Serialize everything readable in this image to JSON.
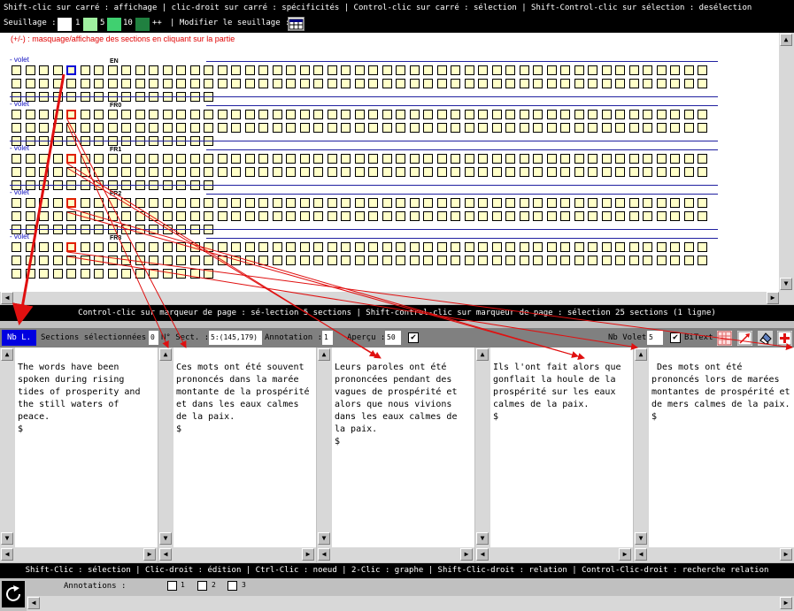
{
  "top_hint": "Shift-clic sur carré : affichage | clic-droit sur carré : spécificités | Control-clic sur carré : sélection | Shift-Control-clic sur sélection : desélection",
  "seuil": {
    "label": "Seuillage :",
    "levels": [
      {
        "value": "1",
        "color": "#ffffff"
      },
      {
        "value": "5",
        "color": "#a0f0a0"
      },
      {
        "value": "10",
        "color": "#40d070"
      },
      {
        "value": "++",
        "color": "#208040"
      }
    ],
    "modify_label": "| Modifier le seuillage :"
  },
  "mask_hint": "(+/-) : masquage/affichage des sections en cliquant sur la partie",
  "volets": [
    {
      "label": "- volet",
      "lang": "EN"
    },
    {
      "label": "- volet",
      "lang": "FR0"
    },
    {
      "label": "- volet",
      "lang": "FR1"
    },
    {
      "label": "- volet",
      "lang": "FR2"
    },
    {
      "label": "- volet",
      "lang": "FR3"
    }
  ],
  "mid_hint": "Control-clic sur marqueur de page : sé-lection 5 sections | Shift-control-clic sur marqueur de page : sélection 25 sections (1 ligne)",
  "toolbar": {
    "nb_l": "Nb L.",
    "sections_label": "Sections sélectionnées :",
    "sections_value": "0",
    "nsect_label": "N° Sect. :",
    "nsect_value": "5:(145,179)",
    "annotation_label": "Annotation :",
    "annotation_value": "1",
    "apercu_label": "Aperçu :",
    "apercu_value": "50",
    "nb_volet_label": "Nb Volet",
    "nb_volet_value": "5",
    "bitext_label": "BiText"
  },
  "columns": [
    {
      "text": "The words have been spoken during rising tides of prosperity and the still waters of peace.\n$"
    },
    {
      "text": "Ces mots ont été souvent prononcés dans la marée montante de la prospérité et dans les eaux calmes de la paix.\n$"
    },
    {
      "text": "Leurs paroles ont été prononcées pendant des vagues de prospérité et alors que nous vivions dans les eaux calmes de la paix.\n$"
    },
    {
      "text": "Ils l'ont fait alors que gonflait la houle de la prospérité sur les eaux calmes de la paix.\n$"
    },
    {
      "text": " Des mots ont été prononcés lors de marées montantes de prospérité et de mers calmes de la paix.\n$"
    }
  ],
  "bottom_hint": "Shift-Clic : sélection | Clic-droit : édition | Ctrl-Clic : noeud | 2-Clic : graphe | Shift-Clic-droit : relation | Control-Clic-droit : recherche relation",
  "annotations": {
    "label": "Annotations :",
    "options": [
      "1",
      "2",
      "3"
    ]
  },
  "icons": {
    "scroll_up": "▲",
    "scroll_down": "▼",
    "scroll_left": "◀",
    "scroll_right": "▶",
    "check": "✔"
  },
  "colors": {
    "square_fill": "#ffffc8",
    "selection_blue": "#0000d8",
    "selection_red": "#e02000",
    "arrow_red": "#e01010"
  }
}
